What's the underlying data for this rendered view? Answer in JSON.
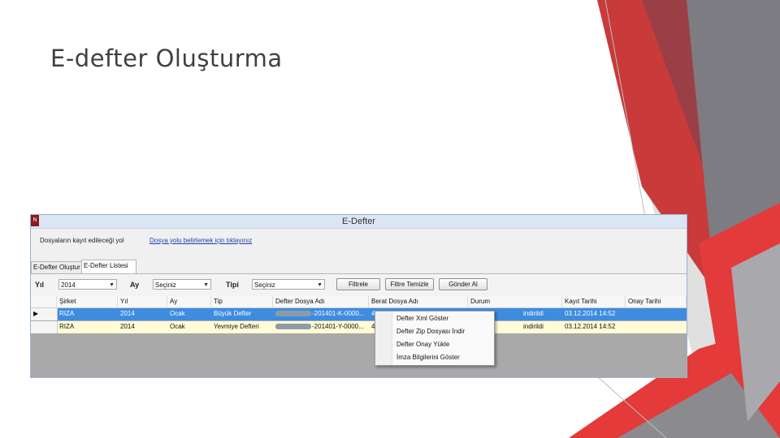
{
  "slide": {
    "title": "E-defter Oluşturma"
  },
  "window": {
    "title": "E-Defter",
    "icon_text": "N",
    "path_label": "Dosyaların kayıt edileceği yol",
    "path_link": "Dosya yolu belirlemek için tıklayınız"
  },
  "tabs": [
    {
      "label": "E-Defter Oluştur"
    },
    {
      "label": "E-Defter Listesi"
    }
  ],
  "filters": {
    "year_label": "Yıl",
    "year_value": "2014",
    "month_label": "Ay",
    "month_value": "Seçiniz",
    "type_label": "Tipi",
    "type_value": "Seçiniz",
    "filter_button": "Filtrele",
    "clear_button": "Filtre Temizle",
    "send_button": "Gönder Al"
  },
  "table": {
    "columns": [
      "Şirket",
      "Yıl",
      "Ay",
      "Tip",
      "Defter Dosya Adı",
      "Berat Dosya Adı",
      "Durum",
      "Kayıt Tarihi",
      "Onay Tarihi"
    ],
    "rows": [
      {
        "marker": "▶",
        "sirket": "RIZA",
        "yil": "2014",
        "ay": "Ocak",
        "tip": "Büyük Defter",
        "defter_dosya": "-201401-K-0000...",
        "berat_dosya": "4",
        "durum": "indirildi",
        "kayit": "03.12.2014 14:52",
        "onay": ""
      },
      {
        "marker": "",
        "sirket": "RIZA",
        "yil": "2014",
        "ay": "Ocak",
        "tip": "Yevmiye Defteri",
        "defter_dosya": "-201401-Y-0000...",
        "berat_dosya": "4",
        "durum": "indirildi",
        "kayit": "03.12.2014 14:52",
        "onay": ""
      }
    ]
  },
  "context_menu": [
    {
      "label": "Defter Xml Göster"
    },
    {
      "label": "Defter Zip Dosyası İndir"
    },
    {
      "label": "Defter Onay Yükle"
    },
    {
      "label": "İmza Bilgilerini Göster"
    }
  ],
  "colors": {
    "accent_red": "#d63b3b",
    "selection_blue": "#3d8ce0",
    "row_yellow": "#fffbd6"
  }
}
